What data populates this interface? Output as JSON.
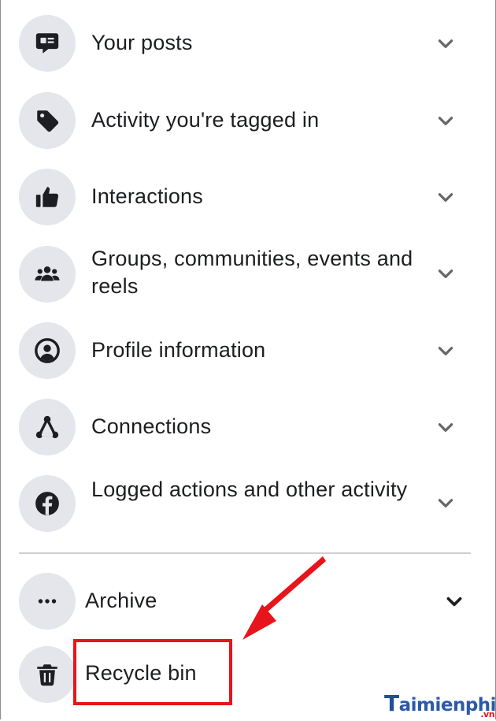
{
  "menu": {
    "items": [
      {
        "label": "Your posts",
        "icon": "comment-post-icon"
      },
      {
        "label": "Activity you're tagged in",
        "icon": "tag-icon"
      },
      {
        "label": "Interactions",
        "icon": "thumbs-up-icon"
      },
      {
        "label": "Groups, communities, events and reels",
        "icon": "people-group-icon"
      },
      {
        "label": "Profile information",
        "icon": "profile-icon"
      },
      {
        "label": "Connections",
        "icon": "connections-icon"
      },
      {
        "label": "Logged actions and other activity",
        "icon": "facebook-icon"
      }
    ],
    "lower_items": [
      {
        "label": "Archive",
        "icon": "more-dots-icon"
      },
      {
        "label": "Recycle bin",
        "icon": "trash-icon"
      }
    ]
  },
  "watermark": {
    "text": "aimienphi",
    "initial": "T",
    "suffix": ".vn"
  },
  "colors": {
    "icon_bg": "#e4e6eb",
    "text": "#1c1e21",
    "highlight": "#e8141b",
    "chevron": "#65676b"
  }
}
